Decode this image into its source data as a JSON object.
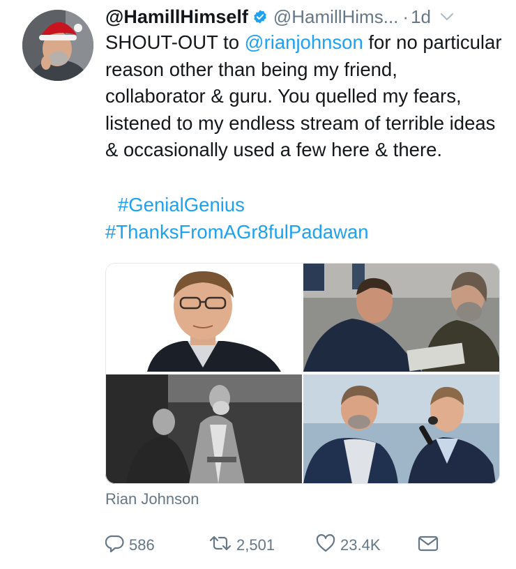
{
  "tweet": {
    "display_name": "@HamillHimself",
    "handle": "@HamillHims...",
    "separator": "·",
    "age": "1d",
    "text_before_mention": "SHOUT-OUT to ",
    "mention": "@rianjohnson",
    "text_after_mention": " for no particular reason other than being my friend, collaborator & guru. You quelled my fears, listened to my endless stream of terrible ideas & occasionally used a few here & there.",
    "hashtags": [
      "#GenialGenius",
      "#ThanksFromAGr8fulPadawan"
    ],
    "photo_caption": "Rian Johnson",
    "reply_count": "586",
    "retweet_count": "2,501",
    "like_count": "23.4K"
  },
  "icons": {
    "verified": "verified-badge-icon",
    "caret": "chevron-down-icon",
    "reply": "reply-icon",
    "retweet": "retweet-icon",
    "like": "heart-icon",
    "dm": "envelope-icon"
  },
  "colors": {
    "link": "#1da1f2",
    "secondary_text": "#657786",
    "primary_text": "#14171a"
  }
}
